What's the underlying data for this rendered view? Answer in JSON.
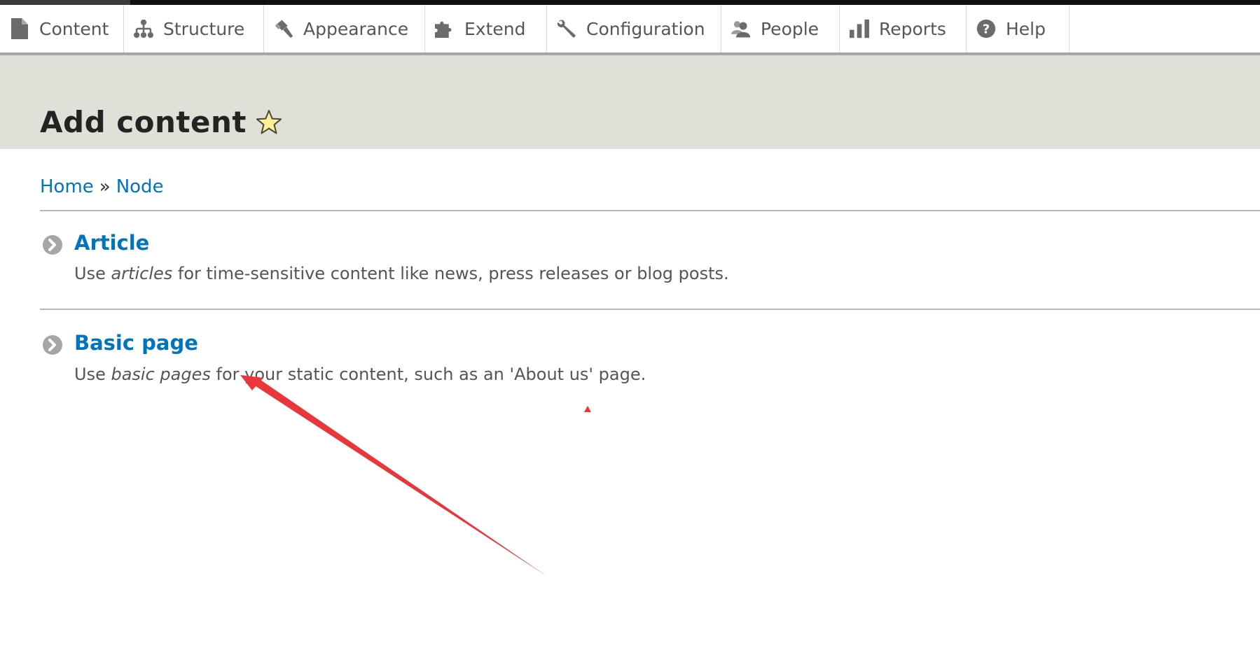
{
  "toolbar": {
    "items": [
      {
        "label": "Content",
        "icon": "document-icon"
      },
      {
        "label": "Structure",
        "icon": "sitemap-icon"
      },
      {
        "label": "Appearance",
        "icon": "paintbrush-icon"
      },
      {
        "label": "Extend",
        "icon": "puzzle-icon"
      },
      {
        "label": "Configuration",
        "icon": "wrench-icon"
      },
      {
        "label": "People",
        "icon": "people-icon"
      },
      {
        "label": "Reports",
        "icon": "bar-chart-icon"
      },
      {
        "label": "Help",
        "icon": "help-icon"
      }
    ]
  },
  "page": {
    "title": "Add content",
    "shortcut_icon": "star-icon"
  },
  "breadcrumb": {
    "items": [
      "Home",
      "Node"
    ],
    "separator": "»"
  },
  "content_types": [
    {
      "title": "Article",
      "desc_prefix": "Use ",
      "desc_em": "articles",
      "desc_suffix": " for time-sensitive content like news, press releases or blog posts."
    },
    {
      "title": "Basic page",
      "desc_prefix": "Use ",
      "desc_em": "basic pages",
      "desc_suffix": " for your static content, such as an 'About us' page."
    }
  ],
  "colors": {
    "link": "#0074bd",
    "header_band": "#e0e0d8",
    "annotation_arrow": "#e8363a"
  }
}
